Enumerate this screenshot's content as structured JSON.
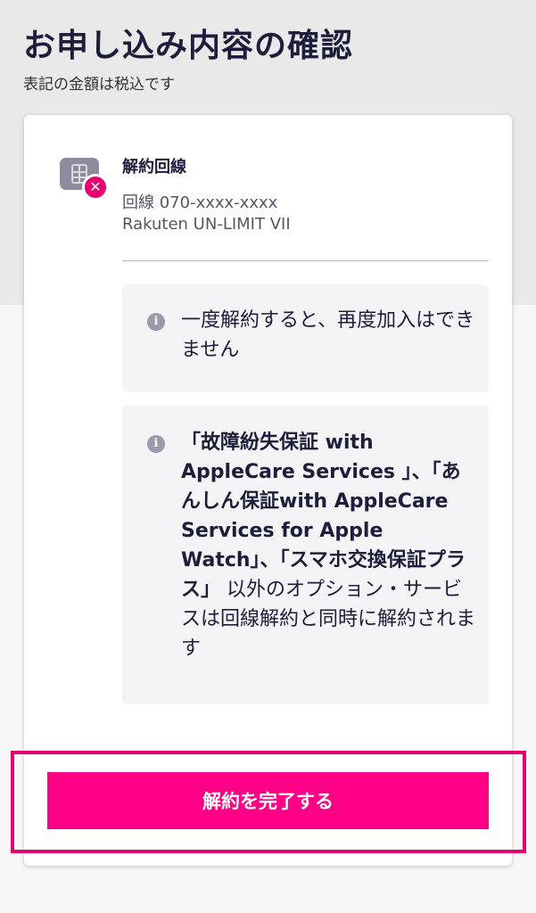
{
  "header": {
    "title": "お申し込み内容の確認",
    "subtitle": "表記の金額は税込です"
  },
  "line": {
    "icon": "sim-card-cancel-icon",
    "heading": "解約回線",
    "number": "回線 070-xxxx-xxxx",
    "plan": "Rakuten UN-LIMIT VII"
  },
  "notices": [
    {
      "icon": "info-icon",
      "text": "一度解約すると、再度加入はできません"
    },
    {
      "icon": "info-icon",
      "bold_1": "「故障紛失保証 with AppleCare Services 」、「あんしん保証with AppleCare Services for Apple Watch」、「スマホ交換保証プラス」",
      "normal_1": " 以外のオプション・サービスは回線解約と同時に解約されます"
    }
  ],
  "actions": {
    "complete_label": "解約を完了する"
  },
  "colors": {
    "accent": "#ff0086",
    "highlight_border": "#e4006f",
    "title": "#1d1d3c",
    "notice_bg": "#f4f4f6"
  }
}
